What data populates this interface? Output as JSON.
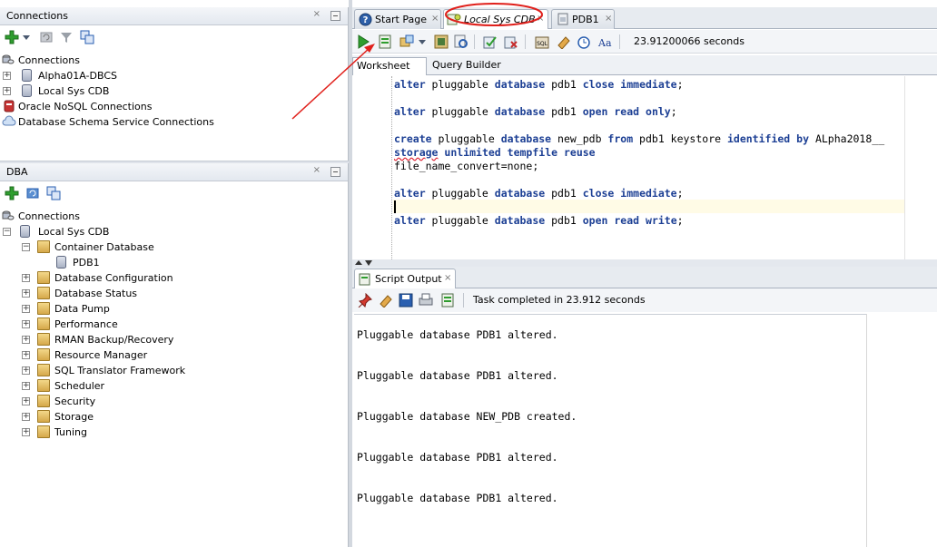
{
  "connections_panel": {
    "title": "Connections",
    "close_glyph": "×",
    "tree_root": "Connections",
    "items": [
      {
        "label": "Alpha01A-DBCS",
        "icon": "database-icon"
      },
      {
        "label": "Local Sys CDB",
        "icon": "database-icon"
      },
      {
        "label": "Oracle NoSQL Connections",
        "icon": "nosql-icon"
      },
      {
        "label": "Database Schema Service Connections",
        "icon": "cloud-icon"
      }
    ]
  },
  "dba_panel": {
    "title": "DBA",
    "close_glyph": "×",
    "tree_root": "Connections",
    "connection": "Local Sys CDB",
    "container": "Container Database",
    "pdb": "PDB1",
    "items": [
      "Database Configuration",
      "Database Status",
      "Data Pump",
      "Performance",
      "RMAN Backup/Recovery",
      "Resource Manager",
      "SQL Translator Framework",
      "Scheduler",
      "Security",
      "Storage",
      "Tuning"
    ]
  },
  "editor": {
    "tabs": [
      {
        "label": "Start Page"
      },
      {
        "label": "Local Sys CDB"
      },
      {
        "label": "PDB1"
      }
    ],
    "tab_close_glyph": "×",
    "elapsed": "23.91200066 seconds",
    "subtabs": [
      "Worksheet",
      "Query Builder"
    ],
    "code_lines": [
      "alter pluggable database pdb1 close immediate;",
      "",
      "alter pluggable database pdb1 open read only;",
      "",
      "create pluggable database new_pdb from pdb1 keystore identified by ALpha2018__",
      "storage unlimited tempfile reuse",
      "file_name_convert=none;",
      "",
      "alter pluggable database pdb1 close immediate;",
      "",
      "alter pluggable database pdb1 open read write;"
    ]
  },
  "script_output": {
    "tab_label": "Script Output",
    "close_glyph": "×",
    "status": "Task completed in 23.912 seconds",
    "lines": [
      "Pluggable database PDB1 altered.",
      "Pluggable database PDB1 altered.",
      "Pluggable database NEW_PDB created.",
      "Pluggable database PDB1 altered.",
      "Pluggable database PDB1 altered."
    ]
  },
  "colors": {
    "keyword": "#1c3f94",
    "annotation": "#e0201b"
  }
}
